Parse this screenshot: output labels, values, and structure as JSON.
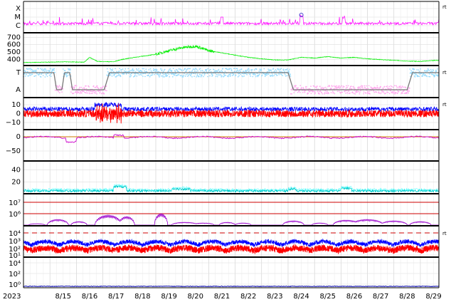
{
  "chart_data": {
    "type": "line",
    "x_axis": {
      "year_label": "2023",
      "date_range": [
        "2023-08-14",
        "2023-08-30"
      ],
      "tick_labels": [
        "8/15",
        "8/16",
        "8/17",
        "8/18",
        "8/19",
        "8/20",
        "8/21",
        "8/22",
        "8/23",
        "8/24",
        "8/25",
        "8/26",
        "8/27",
        "8/28",
        "8/29"
      ],
      "grid": true
    },
    "panels": [
      {
        "id": "flare-class",
        "y_tick_labels": [
          "X",
          "M",
          "C"
        ],
        "right_tag": "rt",
        "series": [
          {
            "color": "#ff00ff",
            "level": 0.18,
            "noise": 0.12,
            "spikes": true
          }
        ],
        "markers": [
          {
            "date": "2023-08-24.5",
            "label": "",
            "color": "#4444cc"
          }
        ]
      },
      {
        "id": "solar-wind-speed",
        "y_tick_labels": [
          "700",
          "600",
          "500",
          "400"
        ],
        "ylim": [
          320,
          760
        ],
        "series": [
          {
            "color": "#00ee00",
            "keyframes": [
              [
                14.0,
                360
              ],
              [
                15.5,
                370
              ],
              [
                16.3,
                365
              ],
              [
                16.5,
                430
              ],
              [
                16.8,
                375
              ],
              [
                17.4,
                370
              ],
              [
                17.7,
                400
              ],
              [
                18.2,
                430
              ],
              [
                19.0,
                470
              ],
              [
                19.5,
                520
              ],
              [
                20.0,
                560
              ],
              [
                20.5,
                580
              ],
              [
                21.0,
                520
              ],
              [
                21.5,
                490
              ],
              [
                22.0,
                460
              ],
              [
                22.5,
                430
              ],
              [
                23.0,
                410
              ],
              [
                23.5,
                395
              ],
              [
                24.0,
                395
              ],
              [
                24.5,
                430
              ],
              [
                25.0,
                420
              ],
              [
                25.5,
                440
              ],
              [
                26.0,
                420
              ],
              [
                26.5,
                430
              ],
              [
                27.0,
                410
              ],
              [
                27.5,
                400
              ],
              [
                28.0,
                390
              ],
              [
                28.5,
                380
              ],
              [
                29.0,
                375
              ],
              [
                29.6,
                390
              ]
            ]
          }
        ]
      },
      {
        "id": "imf-sector",
        "y_tick_labels": [
          "T",
          "A"
        ],
        "right_tag": "rt",
        "series": [
          {
            "color": "#99ddff",
            "role": "toward"
          },
          {
            "color": "#ffaaee",
            "role": "away"
          },
          {
            "color": "#777777",
            "role": "sector",
            "keyframes": [
              [
                14.0,
                1
              ],
              [
                15.15,
                1
              ],
              [
                15.25,
                0
              ],
              [
                15.45,
                0
              ],
              [
                15.55,
                1
              ],
              [
                15.75,
                1
              ],
              [
                15.85,
                0
              ],
              [
                17.05,
                0
              ],
              [
                17.25,
                1
              ],
              [
                24.0,
                1
              ],
              [
                24.2,
                0
              ],
              [
                28.5,
                0
              ],
              [
                28.7,
                1
              ],
              [
                29.6,
                1
              ]
            ]
          }
        ]
      },
      {
        "id": "imf-bz",
        "y_tick_labels": [
          "10",
          "0",
          "−10"
        ],
        "ylim": [
          -18,
          18
        ],
        "right_tag": "rt",
        "series": [
          {
            "color": "#0000ff",
            "level": 5,
            "noise": 2.5
          },
          {
            "color": "#ff0000",
            "level": 0,
            "noise": 4
          }
        ]
      },
      {
        "id": "dst",
        "y_tick_labels": [
          "0",
          "−50"
        ],
        "ylim": [
          -85,
          25
        ],
        "series": [
          {
            "color": "#cc00cc",
            "level": -2,
            "noise": 4
          },
          {
            "color": "#cc7700",
            "role": "zero-line"
          }
        ]
      },
      {
        "id": "proton-density",
        "y_tick_labels": [
          "40",
          "20"
        ],
        "ylim": [
          0,
          55
        ],
        "series": [
          {
            "color": "#00cccc",
            "level": 5,
            "noise": 2
          },
          {
            "color": "#66ffff",
            "level": 7,
            "noise": 2
          }
        ]
      },
      {
        "id": "electron-flux",
        "y_tick_labels": [
          "10⁷",
          "10⁶"
        ],
        "series": [
          {
            "color": "#cc0000",
            "role": "threshold-lines"
          },
          {
            "color": "#9900cc",
            "role": "bumps"
          }
        ]
      },
      {
        "id": "proton-flux",
        "y_tick_labels": [
          "10⁴",
          "10³",
          "10²",
          "10¹"
        ],
        "right_tag": "rt",
        "series": [
          {
            "color": "#cc0000",
            "role": "threshold"
          },
          {
            "color": "#0000ff",
            "role": "flux"
          },
          {
            "color": "#ff0000",
            "role": "flux"
          }
        ]
      },
      {
        "id": "xray-background",
        "y_tick_labels": [
          "10⁴",
          "10²",
          "10⁰"
        ],
        "series": [
          {
            "color": "#0000aa",
            "level": 0.12
          }
        ]
      }
    ]
  }
}
